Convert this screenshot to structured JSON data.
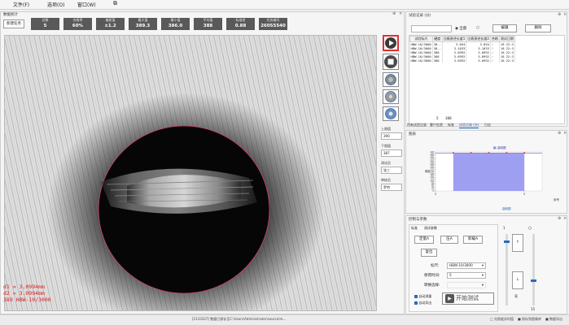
{
  "menu": {
    "file": "文件(F)",
    "options": "选项(O)",
    "window": "窗口(W)"
  },
  "left_panel": {
    "title": "数据统计",
    "new_task": "新建任务",
    "stats": [
      {
        "label": "总数",
        "value": "5"
      },
      {
        "label": "合格率",
        "value": "60%"
      },
      {
        "label": "偏差值",
        "value": "±1.2"
      },
      {
        "label": "最大值",
        "value": "389.3"
      },
      {
        "label": "最小值",
        "value": "386.0"
      },
      {
        "label": "平均值",
        "value": "388"
      },
      {
        "label": "标准差",
        "value": "0.88"
      },
      {
        "label": "任务编号",
        "value": "26055540"
      }
    ]
  },
  "measurements": {
    "d1": "d1 = 3.0994mm",
    "d2": "d2 = 3.0994mm",
    "result": "389 HBW-10/3000"
  },
  "side": {
    "upper_limit_label": "上限值",
    "upper_limit_value": "390",
    "lower_limit_label": "下限值",
    "lower_limit_value": "387",
    "tester_label": "测试员",
    "tester_value": "张三",
    "reviewer_label": "审核员",
    "reviewer_value": "罗特"
  },
  "records": {
    "title": "试验记录 (分)",
    "all_label": "全部",
    "edit": "编辑",
    "delete": "删除",
    "columns": [
      "试验标尺",
      "硬度",
      "压痕直径长度1",
      "压痕直径长度2",
      "合格",
      "测试日期"
    ],
    "rows": [
      [
        "HBW-10/3000",
        "38--",
        "3.094",
        "3.094",
        "✓",
        "18 22:3"
      ],
      [
        "HBW-10/3000",
        "38--",
        "3.1033",
        "3.1033",
        "!",
        "18 22:3"
      ],
      [
        "HBW-10/3000",
        "388",
        "3.0992",
        "3.0992",
        "✓",
        "18 22:3"
      ],
      [
        "HBW-10/3000",
        "388",
        "3.0992",
        "3.0992",
        "✓",
        "18 22:3"
      ],
      [
        "HBW-10/3000",
        "388",
        "3.0992",
        "3.0992",
        "✓",
        "18 22:3"
      ]
    ],
    "footer_count": "5",
    "footer_value": "388"
  },
  "tabs": [
    "所有试验记录",
    "客户信息",
    "标准",
    "试验记录 (分)",
    "日志"
  ],
  "chart_panel": {
    "title": "图表",
    "legend": "曲线图",
    "xlabel": "序号",
    "ylabel": "硬度",
    "link": "曲线图"
  },
  "chart_data": {
    "type": "area",
    "x": [
      1,
      2,
      3,
      4,
      5
    ],
    "values": [
      388,
      388,
      388,
      388,
      388
    ],
    "upper_limit": 390,
    "lower_limit": 387,
    "xlim": [
      0,
      6
    ],
    "ylim": [
      0,
      400
    ],
    "yticks": [
      0,
      20,
      40,
      60,
      80,
      100,
      120,
      140,
      160,
      180,
      200,
      220,
      240,
      260,
      280,
      300,
      320,
      340,
      360,
      380,
      400
    ],
    "xticks": [
      0,
      5
    ]
  },
  "control": {
    "title": "控制与参数",
    "tab_calib": "标准",
    "tab_measure": "测试参数",
    "btn_auto": "定量A",
    "btn_press": "压A",
    "btn_unload": "卸载A",
    "btn_reset": "复位",
    "ruler_label": "标尺:",
    "ruler_value": "HBW-10/3000",
    "dwell_label": "保荷时间:",
    "dwell_value": "5",
    "conversion_label": "转换选择:",
    "auto_measure": "自动测量",
    "auto_export": "自动导出",
    "start_test": "开始测试",
    "slider_top": "1",
    "slider_bottom": "15",
    "light_label": "亮",
    "btn_up": "↑",
    "btn_down": "↓"
  },
  "status": {
    "path": "[2133337] 数据已保存至C:\\Users\\Administrator\\source\\re...",
    "right1": "□ 光照度实时值",
    "right2": "■ 保存到图像库",
    "right3": "■ 数据导出"
  }
}
